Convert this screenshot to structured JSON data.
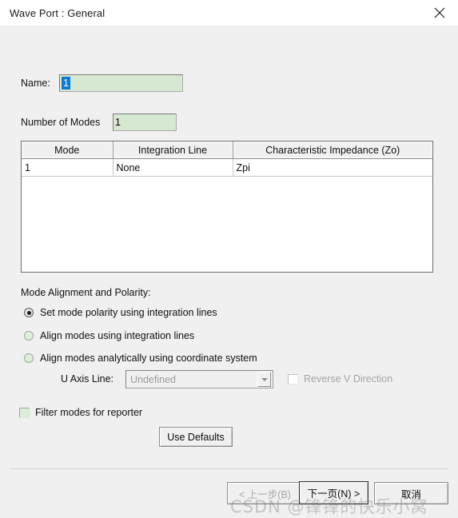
{
  "window": {
    "title": "Wave Port : General",
    "close_icon": "close-icon"
  },
  "form": {
    "name_label": "Name:",
    "name_value": "1",
    "modes_label": "Number of Modes",
    "modes_value": "1"
  },
  "table": {
    "columns": [
      "Mode",
      "Integration Line",
      "Characteristic Impedance (Zo)"
    ],
    "rows": [
      {
        "mode": "1",
        "integration_line": "None",
        "impedance": "Zpi"
      }
    ]
  },
  "alignment": {
    "section_label": "Mode Alignment and Polarity:",
    "options": [
      {
        "label": "Set mode polarity using integration lines",
        "selected": true
      },
      {
        "label": "Align modes using integration lines",
        "selected": false
      },
      {
        "label": "Align modes analytically using coordinate system",
        "selected": false
      }
    ],
    "u_axis_label": "U Axis Line:",
    "u_axis_value": "Undefined",
    "reverse_v_label": "Reverse V Direction"
  },
  "filter": {
    "label": "Filter modes for reporter"
  },
  "buttons": {
    "use_defaults": "Use Defaults",
    "back": "< 上一步(B)",
    "next": "下一页(N) >",
    "cancel": "取消"
  },
  "watermark": {
    "text": "CSDN @锋锋的快乐小窝"
  },
  "colors": {
    "dialog_bg": "#f0f0f0",
    "field_bg": "#d6e8d2",
    "selection_blue": "#0a7bd4",
    "titlebar_bg": "#ffffff"
  }
}
